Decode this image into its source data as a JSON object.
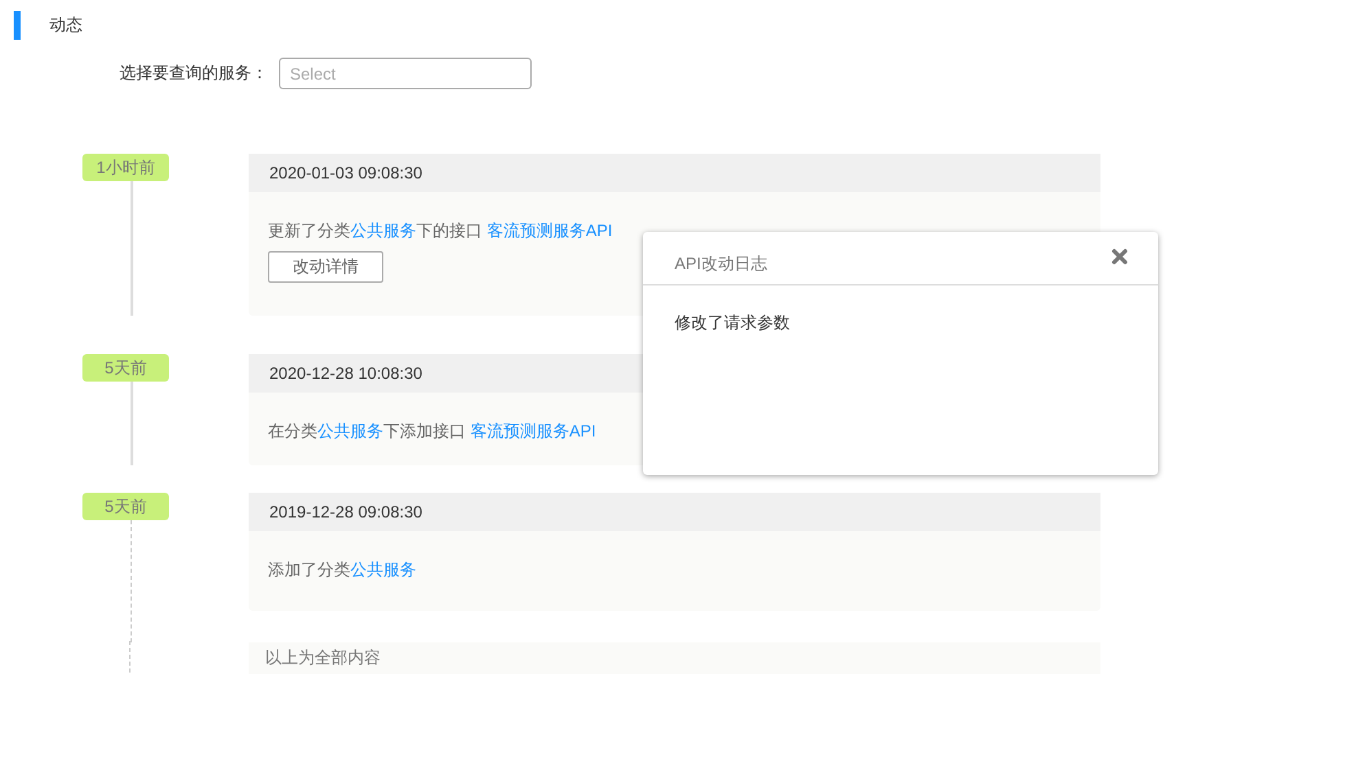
{
  "section_title": "动态",
  "filter": {
    "label": "选择要查询的服务：",
    "placeholder": "Select"
  },
  "events": [
    {
      "ago": "1小时前",
      "time": "2020-01-03 09:08:30",
      "parts": [
        {
          "kind": "text",
          "text": "更新了分类"
        },
        {
          "kind": "link",
          "text": "公共服务"
        },
        {
          "kind": "text",
          "text": "下的接口 "
        },
        {
          "kind": "link",
          "text": "客流预测服务API"
        }
      ],
      "button": "改动详情"
    },
    {
      "ago": "5天前",
      "time": "2020-12-28 10:08:30",
      "parts": [
        {
          "kind": "text",
          "text": "在分类"
        },
        {
          "kind": "link",
          "text": "公共服务"
        },
        {
          "kind": "text",
          "text": "下添加接口 "
        },
        {
          "kind": "link",
          "text": "客流预测服务API"
        }
      ]
    },
    {
      "ago": "5天前",
      "time": "2019-12-28 09:08:30",
      "parts": [
        {
          "kind": "text",
          "text": "添加了分类"
        },
        {
          "kind": "link",
          "text": "公共服务"
        }
      ]
    }
  ],
  "end_note": "以上为全部内容",
  "dialog": {
    "title": "API改动日志",
    "body": "修改了请求参数"
  }
}
